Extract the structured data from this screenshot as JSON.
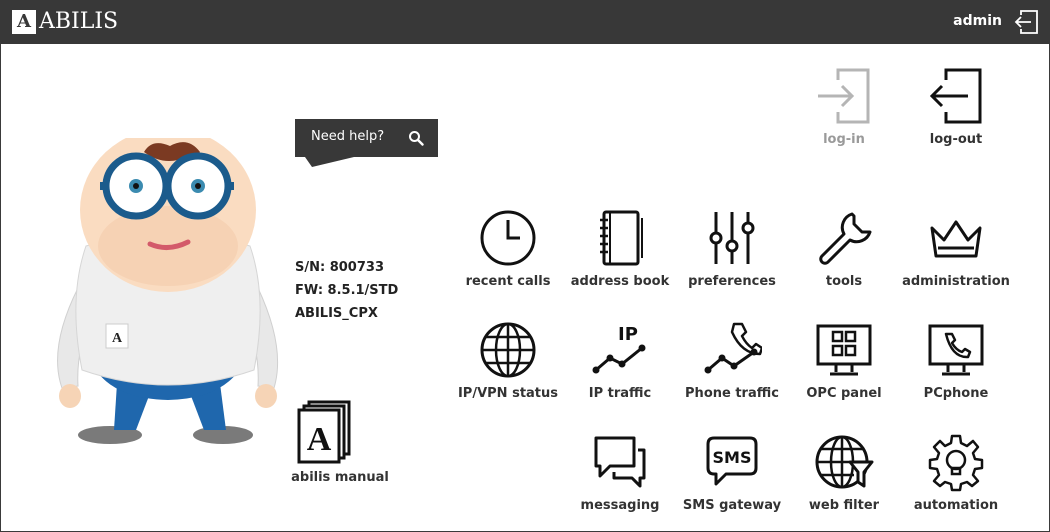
{
  "header": {
    "brand": "ABILIS",
    "brand_initial": "A",
    "user": "admin"
  },
  "help": {
    "label": "Need help?"
  },
  "device": {
    "serial": "S/N: 800733",
    "firmware": "FW: 8.5.1/STD",
    "model": "ABILIS_CPX"
  },
  "manual": {
    "label": "abilis manual"
  },
  "session": {
    "login": "log-in",
    "logout": "log-out"
  },
  "apps": {
    "recent_calls": "recent calls",
    "address_book": "address book",
    "preferences": "preferences",
    "tools": "tools",
    "administration": "administration",
    "ip_vpn_status": "IP/VPN status",
    "ip_traffic": "IP traffic",
    "ip_traffic_tag": "IP",
    "phone_traffic": "Phone traffic",
    "opc_panel": "OPC panel",
    "pcphone": "PCphone",
    "messaging": "messaging",
    "sms_gateway": "SMS gateway",
    "sms_tag": "SMS",
    "web_filter": "web filter",
    "automation": "automation"
  },
  "colors": {
    "topbar": "#383838",
    "icon": "#111111",
    "icon_disabled": "#b5b5b5",
    "glasses": "#1b5b8c",
    "trousers": "#1f67ad"
  }
}
